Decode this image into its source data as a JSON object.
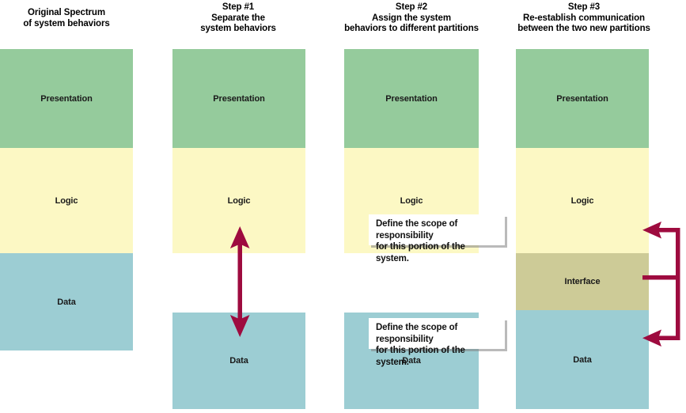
{
  "figure": {
    "background": "#ffffff",
    "accent_arrow_color": "#9e0b3f",
    "columns": [
      {
        "id": "original",
        "header": "Original Spectrum\nof system behaviors",
        "blocks": [
          {
            "label": "Presentation",
            "color": "#95cb9c"
          },
          {
            "label": "Logic",
            "color": "#fcf8c4"
          },
          {
            "label": "Data",
            "color": "#9ccdd3"
          }
        ]
      },
      {
        "id": "step1",
        "header": "Step #1\nSeparate the\nsystem behaviors",
        "blocks": [
          {
            "label": "Presentation",
            "color": "#95cb9c"
          },
          {
            "label": "Logic",
            "color": "#fcf8c4"
          },
          {
            "label": "Data",
            "color": "#9ccdd3"
          }
        ],
        "annotation": "double-headed-vertical-arrow"
      },
      {
        "id": "step2",
        "header": "Step #2\nAssign the system\nbehaviors to different partitions",
        "blocks": [
          {
            "label": "Presentation",
            "color": "#95cb9c"
          },
          {
            "label": "Logic",
            "color": "#fcf8c4"
          },
          {
            "label": "Data",
            "color": "#9ccdd3"
          }
        ],
        "callouts": [
          {
            "text": "Define the scope of responsibility\nfor this portion of the system."
          },
          {
            "text": "Define the scope of responsibility\nfor this portion of the system."
          }
        ]
      },
      {
        "id": "step3",
        "header": "Step #3\nRe-establish communication\nbetween the two new partitions",
        "blocks": [
          {
            "label": "Presentation",
            "color": "#95cb9c"
          },
          {
            "label": "Logic",
            "color": "#fcf8c4"
          },
          {
            "label": "Interface",
            "color": "#cdcb97"
          },
          {
            "label": "Data",
            "color": "#9ccdd3"
          }
        ],
        "annotation": "interface-bracket-connector"
      }
    ]
  }
}
